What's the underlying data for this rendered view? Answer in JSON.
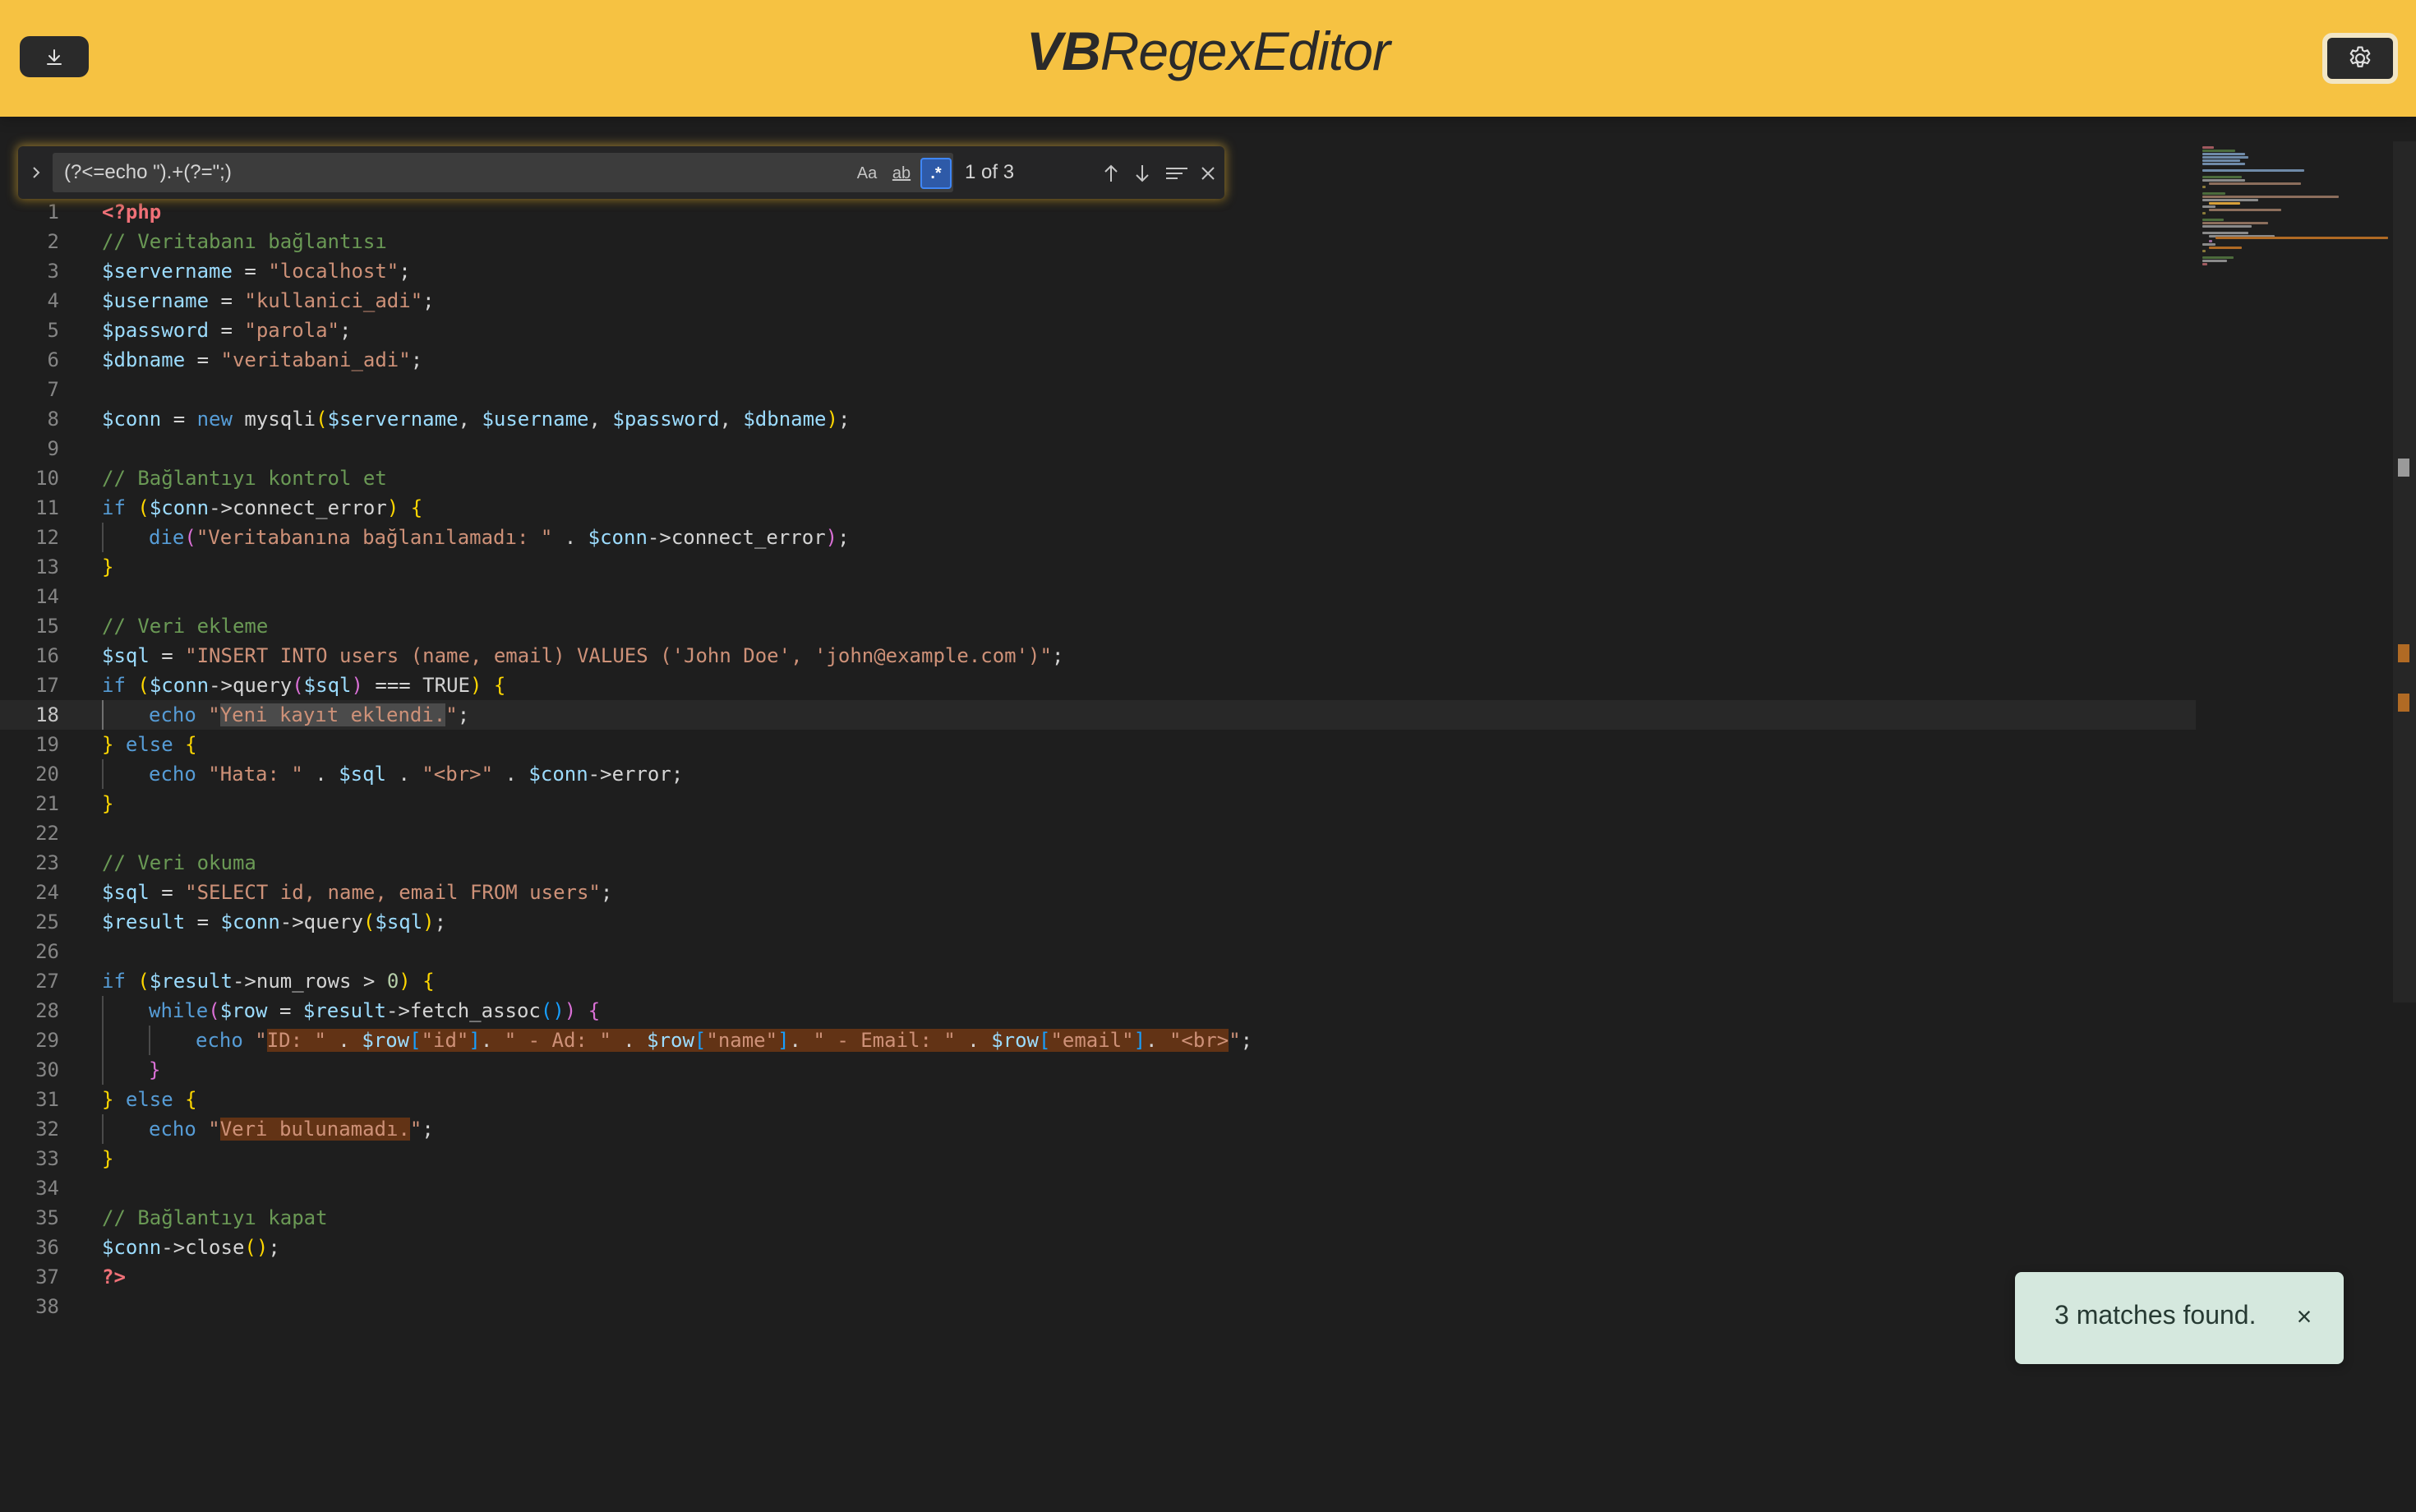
{
  "header": {
    "title_bold": "VB",
    "title_rest": "RegexEditor",
    "background": "#f6c242",
    "download_icon": "download-icon",
    "settings_icon": "gear-icon"
  },
  "find_widget": {
    "query": "(?<=echo \").+(?=\";)",
    "match_case_label": "Aa",
    "whole_word_label": "ab",
    "regex_label": ".*",
    "regex_enabled": true,
    "match_count": "1 of 3",
    "icons": [
      "chevron-right-icon",
      "arrow-up-icon",
      "arrow-down-icon",
      "find-in-selection-icon",
      "close-icon"
    ]
  },
  "editor": {
    "current_line": 18,
    "line_numbers": [
      "1",
      "2",
      "3",
      "4",
      "5",
      "6",
      "7",
      "8",
      "9",
      "10",
      "11",
      "12",
      "13",
      "14",
      "15",
      "16",
      "17",
      "18",
      "19",
      "20",
      "21",
      "22",
      "23",
      "24",
      "25",
      "26",
      "27",
      "28",
      "29",
      "30",
      "31",
      "32",
      "33",
      "34",
      "35",
      "36",
      "37",
      "38"
    ],
    "lines": [
      "<?php",
      "// Veritabanı bağlantısı",
      "$servername = \"localhost\";",
      "$username = \"kullanici_adi\";",
      "$password = \"parola\";",
      "$dbname = \"veritabani_adi\";",
      "",
      "$conn = new mysqli($servername, $username, $password, $dbname);",
      "",
      "// Bağlantıyı kontrol et",
      "if ($conn->connect_error) {",
      "    die(\"Veritabanına bağlanılamadı: \" . $conn->connect_error);",
      "}",
      "",
      "// Veri ekleme",
      "$sql = \"INSERT INTO users (name, email) VALUES ('John Doe', 'john@example.com')\";",
      "if ($conn->query($sql) === TRUE) {",
      "    echo \"Yeni kayıt eklendi.\";",
      "} else {",
      "    echo \"Hata: \" . $sql . \"<br>\" . $conn->error;",
      "}",
      "",
      "// Veri okuma",
      "$sql = \"SELECT id, name, email FROM users\";",
      "$result = $conn->query($sql);",
      "",
      "if ($result->num_rows > 0) {",
      "    while($row = $result->fetch_assoc()) {",
      "        echo \"ID: \" . $row[\"id\"]. \" - Ad: \" . $row[\"name\"]. \" - Email: \" . $row[\"email\"]. \"<br>\";",
      "    }",
      "} else {",
      "    echo \"Veri bulunamadı.\";",
      "}",
      "",
      "// Bağlantıyı kapat",
      "$conn->close();",
      "?>",
      ""
    ]
  },
  "toast": {
    "message": "3 matches found.",
    "close_label": "×"
  }
}
